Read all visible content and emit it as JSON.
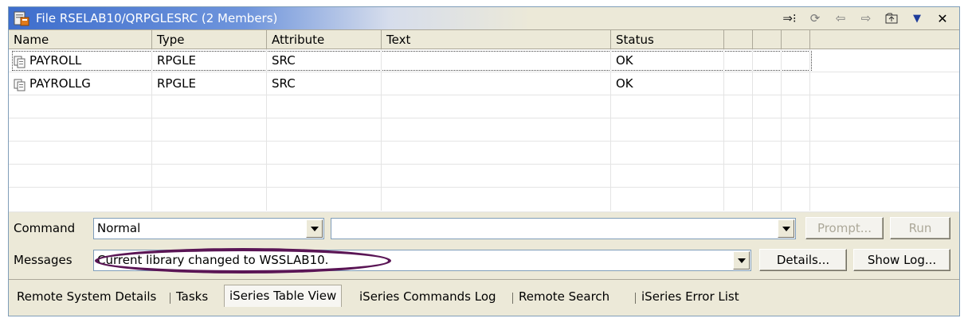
{
  "window": {
    "title": "File RSELAB10/QRPGLESRC (2 Members)",
    "colors": {
      "title_gradient_start": "#3d6dcc",
      "chrome": "#ece9d8",
      "annotation_oval": "#5a1555"
    }
  },
  "toolbar_icons": [
    "filter-icon",
    "refresh-icon",
    "back-icon",
    "forward-icon",
    "up-level-icon",
    "view-menu-icon",
    "close-icon"
  ],
  "table": {
    "columns": [
      "Name",
      "Type",
      "Attribute",
      "Text",
      "Status",
      "",
      "",
      ""
    ],
    "rows": [
      {
        "name": "PAYROLL",
        "type": "RPGLE",
        "attribute": "SRC",
        "text": "",
        "status": "OK"
      },
      {
        "name": "PAYROLLG",
        "type": "RPGLE",
        "attribute": "SRC",
        "text": "",
        "status": "OK"
      }
    ]
  },
  "command": {
    "label": "Command",
    "mode_value": "Normal",
    "command_value": "",
    "prompt_label": "Prompt...",
    "run_label": "Run"
  },
  "messages": {
    "label": "Messages",
    "value": "Current library changed to WSSLAB10.",
    "details_label": "Details...",
    "show_log_label": "Show Log..."
  },
  "tabs": [
    {
      "label": "Remote System Details"
    },
    {
      "label": "Tasks"
    },
    {
      "label": "iSeries Table View",
      "active": true
    },
    {
      "label": "iSeries Commands Log"
    },
    {
      "label": "Remote Search"
    },
    {
      "label": "iSeries Error List"
    }
  ]
}
